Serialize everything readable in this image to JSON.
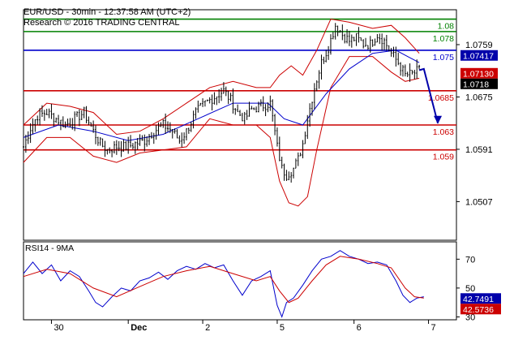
{
  "header": {
    "line1": "EUR/USD - 30min - 12:37:58 AM (UTC+2)",
    "line2": "Research © 2016 TRADING CENTRAL"
  },
  "rsi_panel": {
    "title": "RSI14 - 9MA"
  },
  "colors": {
    "green": "#008000",
    "red": "#cc0000",
    "blue": "#0000cc",
    "candle": "#000000",
    "badge_blue": "#0000aa",
    "badge_red": "#cc0000",
    "badge_black": "#000000"
  },
  "chart_data": [
    {
      "type": "candlestick",
      "title": "EUR/USD - 30min",
      "ylim": [
        1.0445,
        1.0815
      ],
      "y_ticks": [
        "1.0759",
        "1.0675",
        "1.0591",
        "1.0507"
      ],
      "x_ticks": [
        "30",
        "Dec",
        "2",
        "5",
        "6",
        "7"
      ],
      "levels": [
        {
          "label": "1.08",
          "value": 1.08,
          "color": "#008000"
        },
        {
          "label": "1.078",
          "value": 1.078,
          "color": "#008000"
        },
        {
          "label": "1.075",
          "value": 1.075,
          "color": "#0000cc"
        },
        {
          "label": "1.0685",
          "value": 1.0685,
          "color": "#cc0000"
        },
        {
          "label": "1.063",
          "value": 1.063,
          "color": "#cc0000"
        },
        {
          "label": "1.059",
          "value": 1.059,
          "color": "#cc0000"
        }
      ],
      "price_badges": [
        {
          "label": "1.07417",
          "value": 1.07417,
          "color": "#0000aa"
        },
        {
          "label": "1.07130",
          "value": 1.0713,
          "color": "#cc0000"
        },
        {
          "label": "1.0718",
          "value": 1.0718,
          "color": "#000000"
        }
      ],
      "close_path": [
        [
          0,
          1.0595
        ],
        [
          3,
          1.0625
        ],
        [
          6,
          1.0645
        ],
        [
          10,
          1.065
        ],
        [
          14,
          1.064
        ],
        [
          18,
          1.063
        ],
        [
          22,
          1.064
        ],
        [
          26,
          1.065
        ],
        [
          30,
          1.062
        ],
        [
          33,
          1.06
        ],
        [
          36,
          1.059
        ],
        [
          40,
          1.0595
        ],
        [
          44,
          1.0595
        ],
        [
          48,
          1.06
        ],
        [
          52,
          1.0605
        ],
        [
          56,
          1.062
        ],
        [
          60,
          1.063
        ],
        [
          64,
          1.062
        ],
        [
          67,
          1.0605
        ],
        [
          70,
          1.062
        ],
        [
          74,
          1.065
        ],
        [
          78,
          1.0665
        ],
        [
          82,
          1.0675
        ],
        [
          86,
          1.0685
        ],
        [
          89,
          1.067
        ],
        [
          92,
          1.065
        ],
        [
          95,
          1.064
        ],
        [
          98,
          1.0655
        ],
        [
          102,
          1.066
        ],
        [
          106,
          1.0665
        ],
        [
          109,
          1.0595
        ],
        [
          111,
          1.056
        ],
        [
          113,
          1.055
        ],
        [
          116,
          1.056
        ],
        [
          118,
          1.0575
        ],
        [
          120,
          1.06
        ],
        [
          122,
          1.064
        ],
        [
          125,
          1.069
        ],
        [
          128,
          1.073
        ],
        [
          131,
          1.0755
        ],
        [
          134,
          1.079
        ],
        [
          137,
          1.0775
        ],
        [
          140,
          1.0765
        ],
        [
          143,
          1.077
        ],
        [
          146,
          1.076
        ],
        [
          149,
          1.076
        ],
        [
          152,
          1.0775
        ],
        [
          155,
          1.0765
        ],
        [
          158,
          1.0745
        ],
        [
          161,
          1.073
        ],
        [
          164,
          1.071
        ],
        [
          167,
          1.0712
        ],
        [
          170,
          1.0718
        ]
      ],
      "bollinger_upper": [
        [
          0,
          1.063
        ],
        [
          10,
          1.0665
        ],
        [
          20,
          1.066
        ],
        [
          30,
          1.065
        ],
        [
          40,
          1.0615
        ],
        [
          50,
          1.062
        ],
        [
          60,
          1.064
        ],
        [
          70,
          1.0665
        ],
        [
          80,
          1.069
        ],
        [
          90,
          1.07
        ],
        [
          100,
          1.069
        ],
        [
          106,
          1.069
        ],
        [
          110,
          1.071
        ],
        [
          115,
          1.0725
        ],
        [
          120,
          1.071
        ],
        [
          126,
          1.075
        ],
        [
          132,
          1.08
        ],
        [
          140,
          1.0795
        ],
        [
          150,
          1.0785
        ],
        [
          158,
          1.079
        ],
        [
          164,
          1.077
        ],
        [
          170,
          1.0745
        ]
      ],
      "bollinger_lower": [
        [
          0,
          1.057
        ],
        [
          10,
          1.061
        ],
        [
          20,
          1.061
        ],
        [
          30,
          1.058
        ],
        [
          40,
          1.057
        ],
        [
          50,
          1.0585
        ],
        [
          60,
          1.059
        ],
        [
          70,
          1.0595
        ],
        [
          80,
          1.064
        ],
        [
          90,
          1.063
        ],
        [
          100,
          1.063
        ],
        [
          106,
          1.061
        ],
        [
          110,
          1.054
        ],
        [
          114,
          1.0505
        ],
        [
          118,
          1.05
        ],
        [
          122,
          1.0515
        ],
        [
          126,
          1.059
        ],
        [
          132,
          1.069
        ],
        [
          140,
          1.074
        ],
        [
          150,
          1.074
        ],
        [
          158,
          1.0715
        ],
        [
          164,
          1.07
        ],
        [
          170,
          1.0705
        ]
      ],
      "moving_average": [
        [
          0,
          1.061
        ],
        [
          15,
          1.063
        ],
        [
          30,
          1.062
        ],
        [
          45,
          1.0605
        ],
        [
          60,
          1.0615
        ],
        [
          75,
          1.064
        ],
        [
          90,
          1.0665
        ],
        [
          105,
          1.0665
        ],
        [
          112,
          1.064
        ],
        [
          120,
          1.063
        ],
        [
          130,
          1.068
        ],
        [
          140,
          1.072
        ],
        [
          150,
          1.0745
        ],
        [
          160,
          1.075
        ],
        [
          170,
          1.073
        ]
      ],
      "forecast": [
        [
          170,
          1.0718
        ],
        [
          172,
          1.072
        ],
        [
          178,
          1.0633
        ]
      ]
    },
    {
      "type": "line",
      "title": "RSI14 - 9MA",
      "ylim": [
        28,
        82
      ],
      "y_ticks": [
        "70",
        "50",
        "30"
      ],
      "series": [
        {
          "name": "RSI14",
          "color": "#0000cc",
          "values": [
            [
              0,
              60
            ],
            [
              4,
              68
            ],
            [
              8,
              60
            ],
            [
              12,
              66
            ],
            [
              16,
              55
            ],
            [
              20,
              62
            ],
            [
              24,
              58
            ],
            [
              28,
              48
            ],
            [
              31,
              40
            ],
            [
              34,
              37
            ],
            [
              38,
              44
            ],
            [
              42,
              50
            ],
            [
              46,
              48
            ],
            [
              50,
              55
            ],
            [
              54,
              57
            ],
            [
              58,
              61
            ],
            [
              62,
              56
            ],
            [
              66,
              62
            ],
            [
              70,
              65
            ],
            [
              74,
              63
            ],
            [
              78,
              67
            ],
            [
              82,
              64
            ],
            [
              86,
              66
            ],
            [
              90,
              55
            ],
            [
              94,
              45
            ],
            [
              98,
              55
            ],
            [
              102,
              58
            ],
            [
              106,
              62
            ],
            [
              109,
              38
            ],
            [
              111,
              30
            ],
            [
              113,
              40
            ],
            [
              116,
              43
            ],
            [
              120,
              52
            ],
            [
              124,
              62
            ],
            [
              128,
              70
            ],
            [
              132,
              72
            ],
            [
              136,
              76
            ],
            [
              140,
              72
            ],
            [
              144,
              70
            ],
            [
              148,
              67
            ],
            [
              152,
              68
            ],
            [
              156,
              66
            ],
            [
              160,
              55
            ],
            [
              163,
              45
            ],
            [
              166,
              40
            ],
            [
              169,
              43
            ],
            [
              172,
              44
            ]
          ]
        },
        {
          "name": "9MA",
          "color": "#cc0000",
          "values": [
            [
              0,
              58
            ],
            [
              10,
              63
            ],
            [
              20,
              60
            ],
            [
              30,
              50
            ],
            [
              40,
              44
            ],
            [
              50,
              51
            ],
            [
              60,
              58
            ],
            [
              70,
              62
            ],
            [
              80,
              65
            ],
            [
              90,
              60
            ],
            [
              100,
              55
            ],
            [
              106,
              58
            ],
            [
              110,
              48
            ],
            [
              114,
              40
            ],
            [
              118,
              43
            ],
            [
              124,
              55
            ],
            [
              130,
              66
            ],
            [
              136,
              72
            ],
            [
              144,
              70
            ],
            [
              152,
              67
            ],
            [
              158,
              64
            ],
            [
              164,
              50
            ],
            [
              168,
              44
            ],
            [
              172,
              43
            ]
          ]
        }
      ],
      "badges": [
        {
          "label": "42.7491",
          "value": 42.7491,
          "color": "#0000aa"
        },
        {
          "label": "42.5736",
          "value": 42.5736,
          "color": "#cc0000"
        }
      ]
    }
  ]
}
